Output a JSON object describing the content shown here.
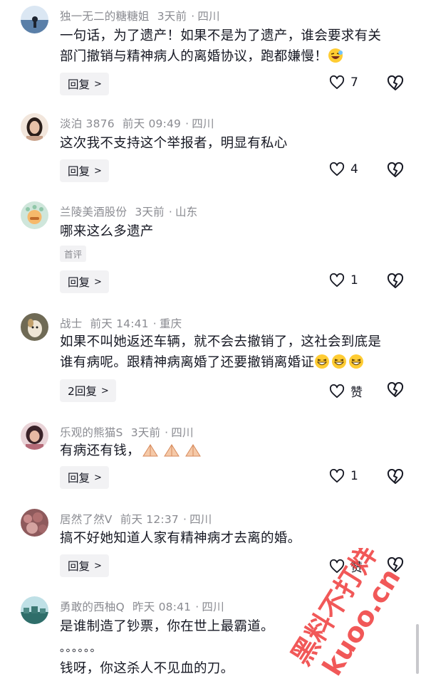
{
  "comments": [
    {
      "user": "独一无二的糖糖姐",
      "time": "3天前",
      "location": "四川",
      "lines": [
        "一句话，为了遗产！如果不是为了遗产，谁会要求有关",
        "部门撤销与精神病人的离婚协议，跑都嫌慢！"
      ],
      "reply_label": "回复",
      "likes": "7",
      "avatar_color": "#5a7fa8"
    },
    {
      "user": "淡泊 3876",
      "time": "前天 09:49",
      "location": "四川",
      "lines": [
        "这次我不支持这个举报者，明显有私心"
      ],
      "reply_label": "回复",
      "likes": "4",
      "avatar_color": "#c9a38c"
    },
    {
      "user": "兰陵美酒股份",
      "time": "3天前",
      "location": "山东",
      "lines": [
        "哪来这么多遗产"
      ],
      "tag": "首评",
      "reply_label": "回复",
      "likes": "1",
      "avatar_color": "#9fcfb6"
    },
    {
      "user": "战士",
      "time": "前天 14:41",
      "location": "重庆",
      "lines": [
        "如果不叫她返还车辆，就不会去撤销了，这社会到底是",
        "谁有病呢。跟精神病离婚了还要撤销离婚证"
      ],
      "reply_label": "2回复",
      "likes": "赞",
      "avatar_color": "#8a7a5e"
    },
    {
      "user": "乐观的熊猫S",
      "time": "3天前",
      "location": "四川",
      "lines": [
        "有病还有钱，"
      ],
      "reply_label": "回复",
      "likes": "1",
      "avatar_color": "#b56a78"
    },
    {
      "user": "居然了然V",
      "time": "前天 12:37",
      "location": "四川",
      "lines": [
        "搞不好她知道人家有精神病才去离的婚。"
      ],
      "reply_label": "回复",
      "likes": "赞",
      "avatar_color": "#a3686a"
    },
    {
      "user": "勇敢的西柚Q",
      "time": "昨天 08:41",
      "location": "四川",
      "lines": [
        "是谁制造了钞票，你在世上最霸道。",
        "。。。。。。",
        "钱呀，你这杀人不见血的刀。"
      ],
      "avatar_color": "#4d8a86"
    }
  ],
  "separator": "·",
  "watermark": {
    "line1": "黑料不打烊",
    "line2": "kuoo.cn",
    "color": "#ee3b3b"
  },
  "icons": [
    "heart-icon",
    "heart-broken-icon",
    "chevron-right-icon",
    "grin-squint-emoji",
    "laughing-emoji",
    "praying-hands-emoji"
  ]
}
